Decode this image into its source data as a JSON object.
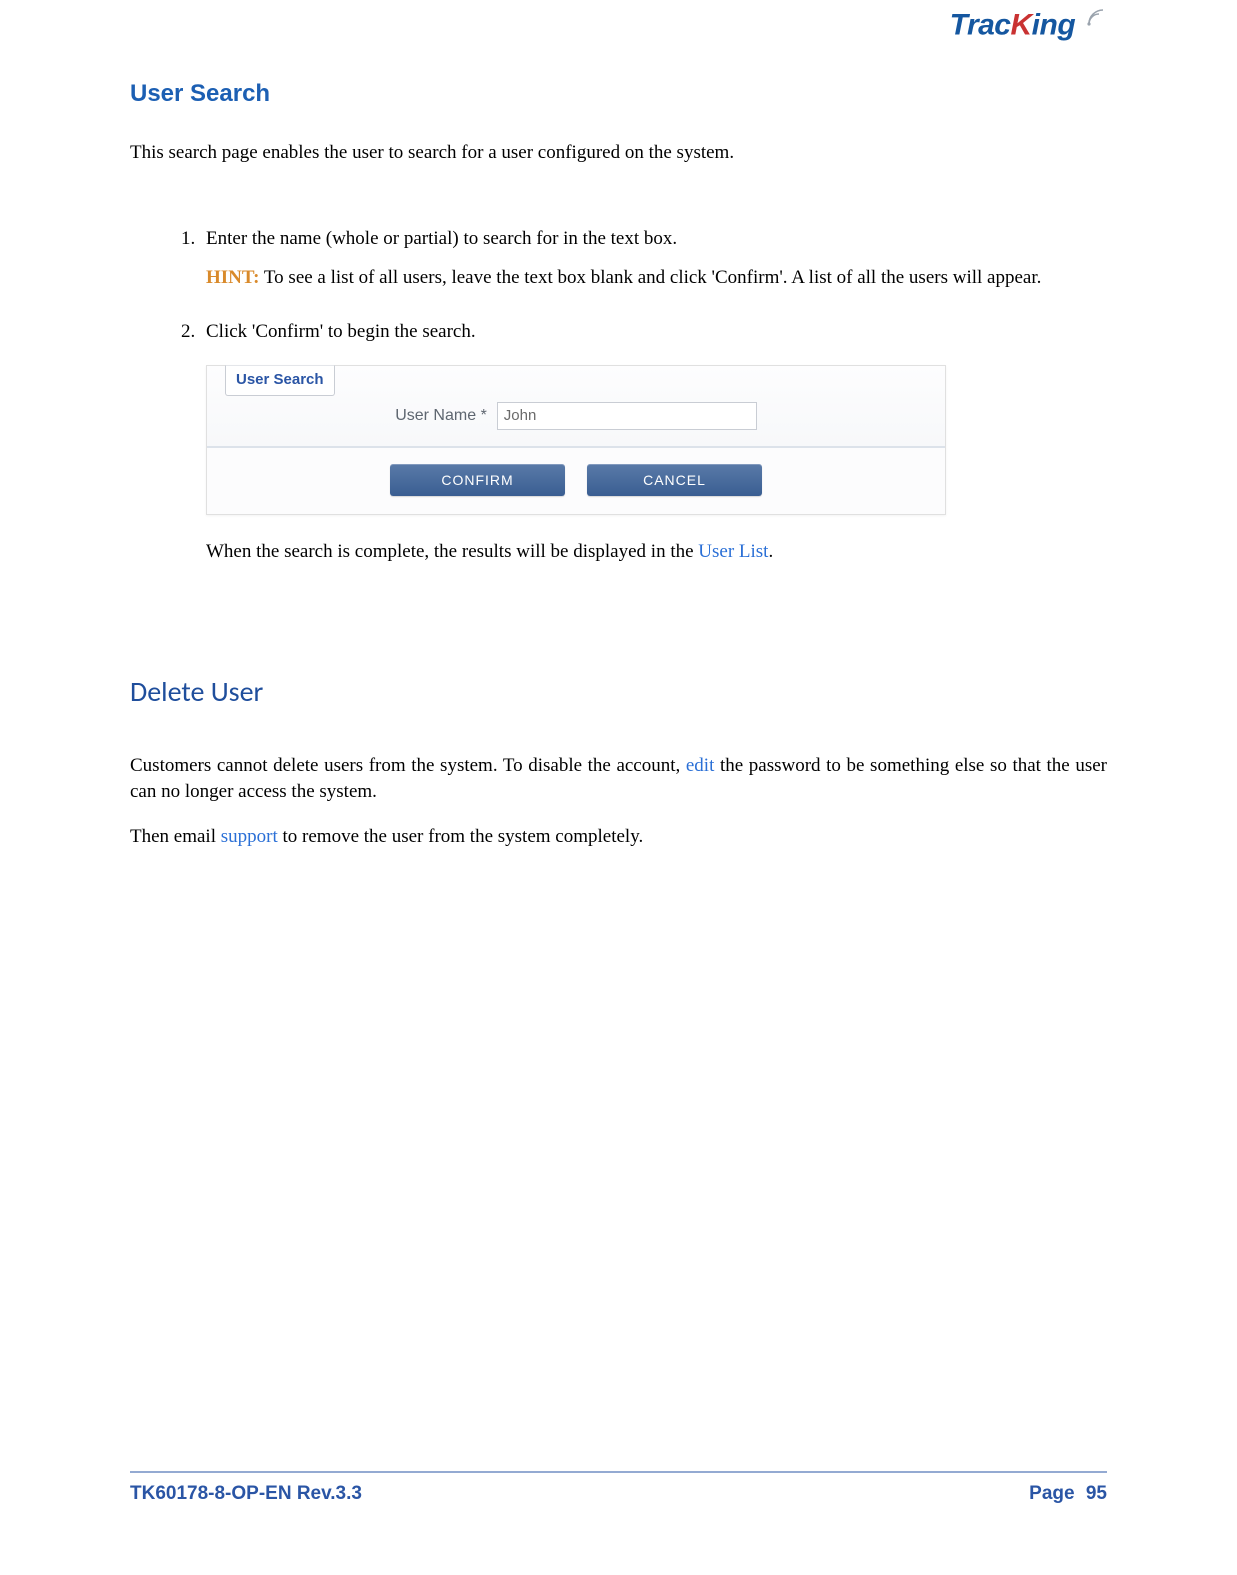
{
  "logo": {
    "part1": "Trac",
    "part2": "K",
    "part3": "ing"
  },
  "section1": {
    "title": "User Search",
    "intro": "This search page enables the user to search for a user configured on the system.",
    "step1": "Enter the name (whole or partial) to search for in the text box.",
    "hint_label": "HINT:",
    "hint_text": " To see a list of all users, leave the text box blank and click 'Confirm'. A list of all the users will appear.",
    "step2": "Click 'Confirm' to begin the search.",
    "after_figure_pre": "When the search is complete, the results will be displayed in the ",
    "after_figure_link": "User List",
    "after_figure_post": "."
  },
  "widget": {
    "fieldset_title": "User Search",
    "field_label": "User Name",
    "required_mark": "*",
    "input_value": "John",
    "confirm": "CONFIRM",
    "cancel": "CANCEL"
  },
  "section2": {
    "title": "Delete User",
    "p1_pre": "Customers cannot delete users from the system. To disable the account, ",
    "p1_link": "edit",
    "p1_post": " the password to be something else so that the user can no longer access the system.",
    "p2_pre": "Then email ",
    "p2_link": "support",
    "p2_post": " to remove the user from the system completely."
  },
  "footer": {
    "doc_id": "TK60178-8-OP-EN Rev.3.3",
    "page_label": "Page",
    "page_num": "95"
  }
}
